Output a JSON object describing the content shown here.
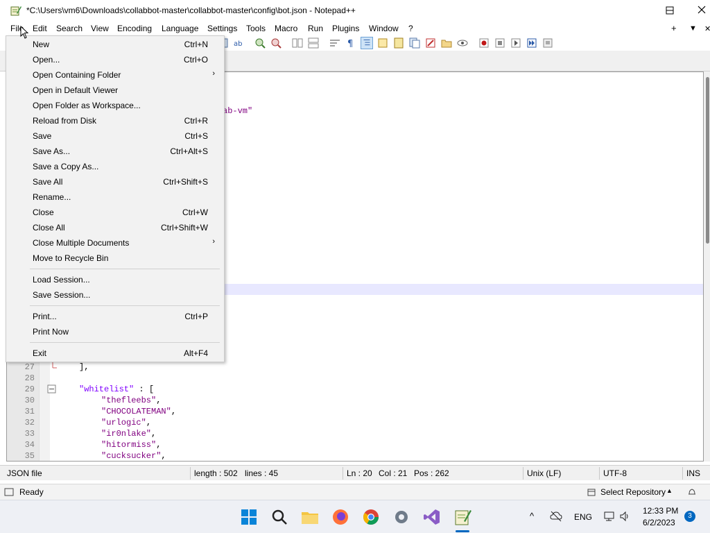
{
  "window": {
    "title": "*C:\\Users\\vm6\\Downloads\\collabbot-master\\collabbot-master\\config\\bot.json - Notepad++"
  },
  "menubar": {
    "items": [
      "File",
      "Edit",
      "Search",
      "View",
      "Encoding",
      "Language",
      "Settings",
      "Tools",
      "Macro",
      "Run",
      "Plugins",
      "Window",
      "?"
    ],
    "right_plus": "+",
    "right_down": "▼",
    "right_close": "✕"
  },
  "file_menu": {
    "items": [
      {
        "label": "New",
        "shortcut": "Ctrl+N"
      },
      {
        "label": "Open...",
        "shortcut": "Ctrl+O"
      },
      {
        "label": "Open Containing Folder",
        "shortcut": "",
        "submenu": true
      },
      {
        "label": "Open in Default Viewer",
        "shortcut": ""
      },
      {
        "label": "Open Folder as Workspace...",
        "shortcut": ""
      },
      {
        "label": "Reload from Disk",
        "shortcut": "Ctrl+R"
      },
      {
        "label": "Save",
        "shortcut": "Ctrl+S"
      },
      {
        "label": "Save As...",
        "shortcut": "Ctrl+Alt+S"
      },
      {
        "label": "Save a Copy As...",
        "shortcut": ""
      },
      {
        "label": "Save All",
        "shortcut": "Ctrl+Shift+S"
      },
      {
        "label": "Rename...",
        "shortcut": ""
      },
      {
        "label": "Close",
        "shortcut": "Ctrl+W"
      },
      {
        "label": "Close All",
        "shortcut": "Ctrl+Shift+W"
      },
      {
        "label": "Close Multiple Documents",
        "shortcut": "",
        "submenu": true
      },
      {
        "label": "Move to Recycle Bin",
        "shortcut": ""
      },
      {
        "label": "Load Session...",
        "shortcut": ""
      },
      {
        "label": "Save Session...",
        "shortcut": ""
      },
      {
        "label": "Print...",
        "shortcut": "Ctrl+P"
      },
      {
        "label": "Print Now",
        "shortcut": ""
      },
      {
        "label": "Exit",
        "shortcut": "Alt+F4"
      }
    ]
  },
  "editor": {
    "visible_fragment_1": "ab-vm\"",
    "lines": [
      {
        "num": "27",
        "text": "],"
      },
      {
        "num": "28",
        "text": ""
      },
      {
        "num": "29",
        "key": "\"whitelist\"",
        "rest": " : ["
      },
      {
        "num": "30",
        "str": "\"thefleebs\"",
        "rest": ","
      },
      {
        "num": "31",
        "str": "\"CHOCOLATEMAN\"",
        "rest": ","
      },
      {
        "num": "32",
        "str": "\"urlogic\"",
        "rest": ","
      },
      {
        "num": "33",
        "str": "\"ir0nlake\"",
        "rest": ","
      },
      {
        "num": "34",
        "str": "\"hitormiss\"",
        "rest": ","
      },
      {
        "num": "35",
        "str": "\"cucksucker\"",
        "rest": ","
      }
    ]
  },
  "statusbar": {
    "filetype": "JSON file",
    "length": "length : 502",
    "lines": "lines : 45",
    "ln": "Ln : 20",
    "col": "Col : 21",
    "pos": "Pos : 262",
    "eol": "Unix (LF)",
    "encoding": "UTF-8",
    "mode": "INS"
  },
  "vs_status": {
    "ready": "Ready",
    "repo": "Select Repository"
  },
  "taskbar": {
    "lang": "ENG",
    "time": "12:33 PM",
    "date": "6/2/2023",
    "notifications": "3"
  },
  "colors": {
    "selection_blue": "#0078d7",
    "caret_line": "#e8e8ff",
    "string_purple": "#800080",
    "key_purple": "#8000ff"
  }
}
